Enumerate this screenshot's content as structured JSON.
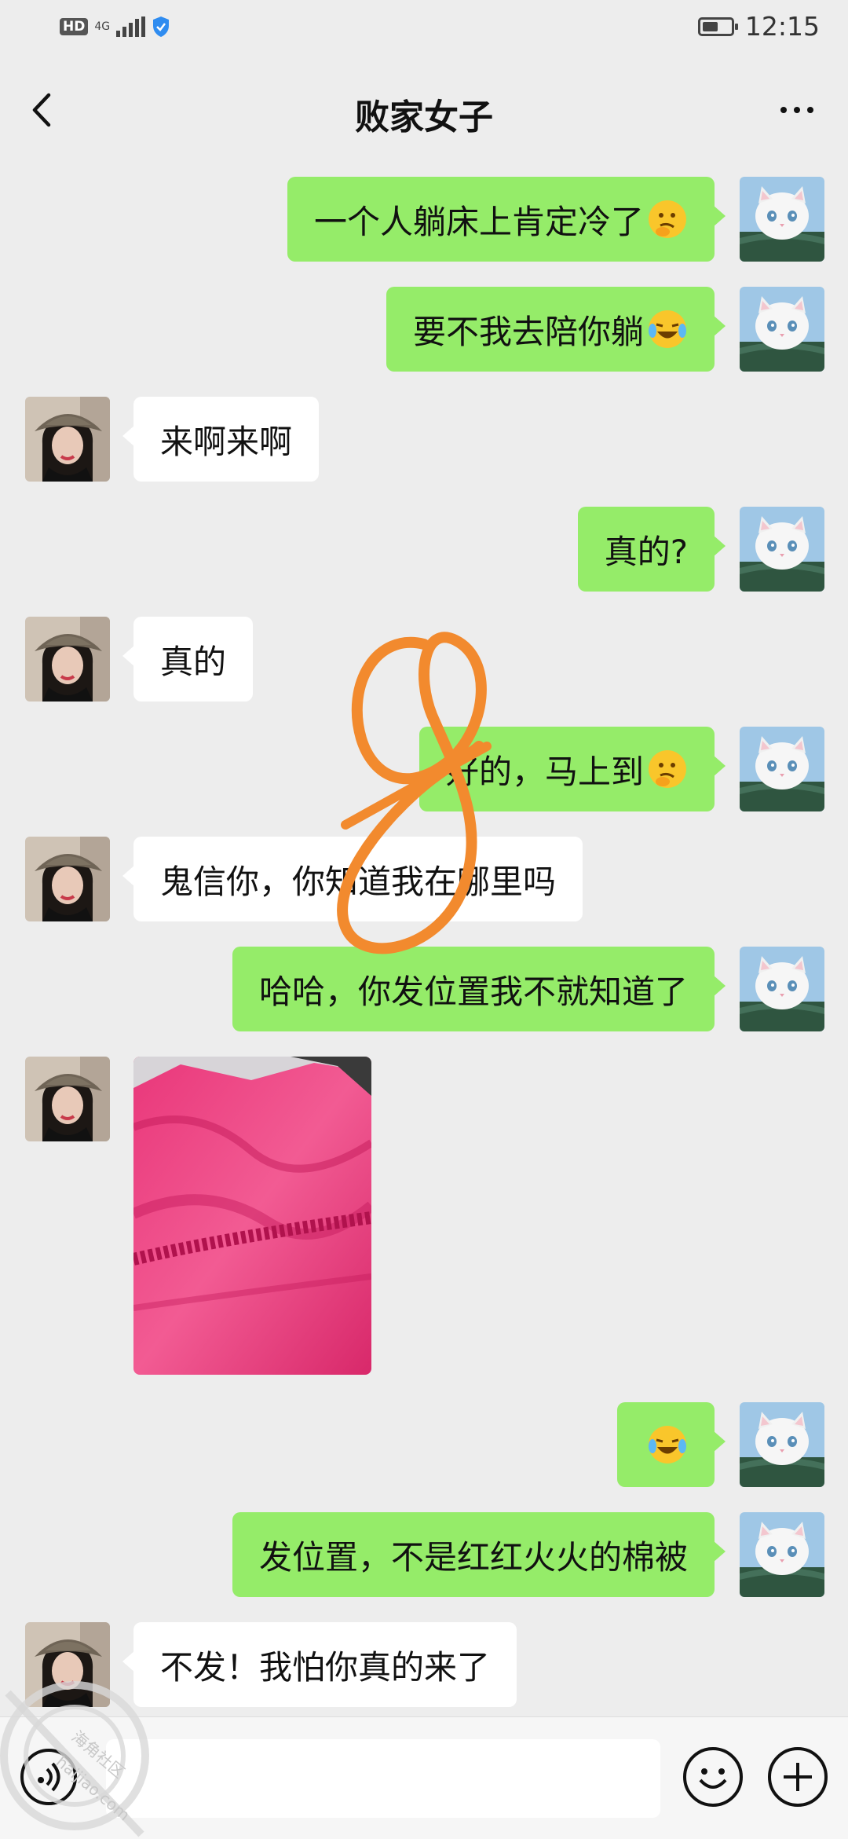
{
  "status_bar": {
    "network_badge": "HD",
    "network_type": "4G",
    "time": "12:15",
    "battery_level": 0.55
  },
  "header": {
    "title": "败家女子",
    "back_icon": "chevron-left-icon",
    "more_icon": "more-dots-icon"
  },
  "messages": [
    {
      "from": "me",
      "text": "一个人躺床上肯定冷了",
      "emoji": "thinking-face"
    },
    {
      "from": "me",
      "text": "要不我去陪你躺",
      "emoji": "laughing-crying-face"
    },
    {
      "from": "them",
      "text": "来啊来啊"
    },
    {
      "from": "me",
      "text": "真的?"
    },
    {
      "from": "them",
      "text": "真的"
    },
    {
      "from": "me",
      "text": "好的，马上到",
      "emoji": "thinking-face"
    },
    {
      "from": "them",
      "text": "鬼信你，你知道我在哪里吗"
    },
    {
      "from": "me",
      "text": "哈哈，你发位置我不就知道了"
    },
    {
      "from": "them",
      "type": "image",
      "description": "pink blanket photo"
    },
    {
      "from": "me",
      "text": "",
      "emoji": "laughing-crying-face"
    },
    {
      "from": "me",
      "text": "发位置，不是红红火火的棉被"
    },
    {
      "from": "them",
      "text": "不发！我怕你真的来了"
    }
  ],
  "annotation": {
    "glyph": "8",
    "color": "#f28a2e"
  },
  "watermark": {
    "text": "海角社区",
    "sub": "haijiao.com"
  },
  "input_bar": {
    "voice_icon": "voice-icon",
    "emoji_icon": "emoji-icon",
    "plus_icon": "plus-icon"
  },
  "colors": {
    "background": "#ededed",
    "my_bubble": "#95ec69",
    "their_bubble": "#ffffff"
  }
}
